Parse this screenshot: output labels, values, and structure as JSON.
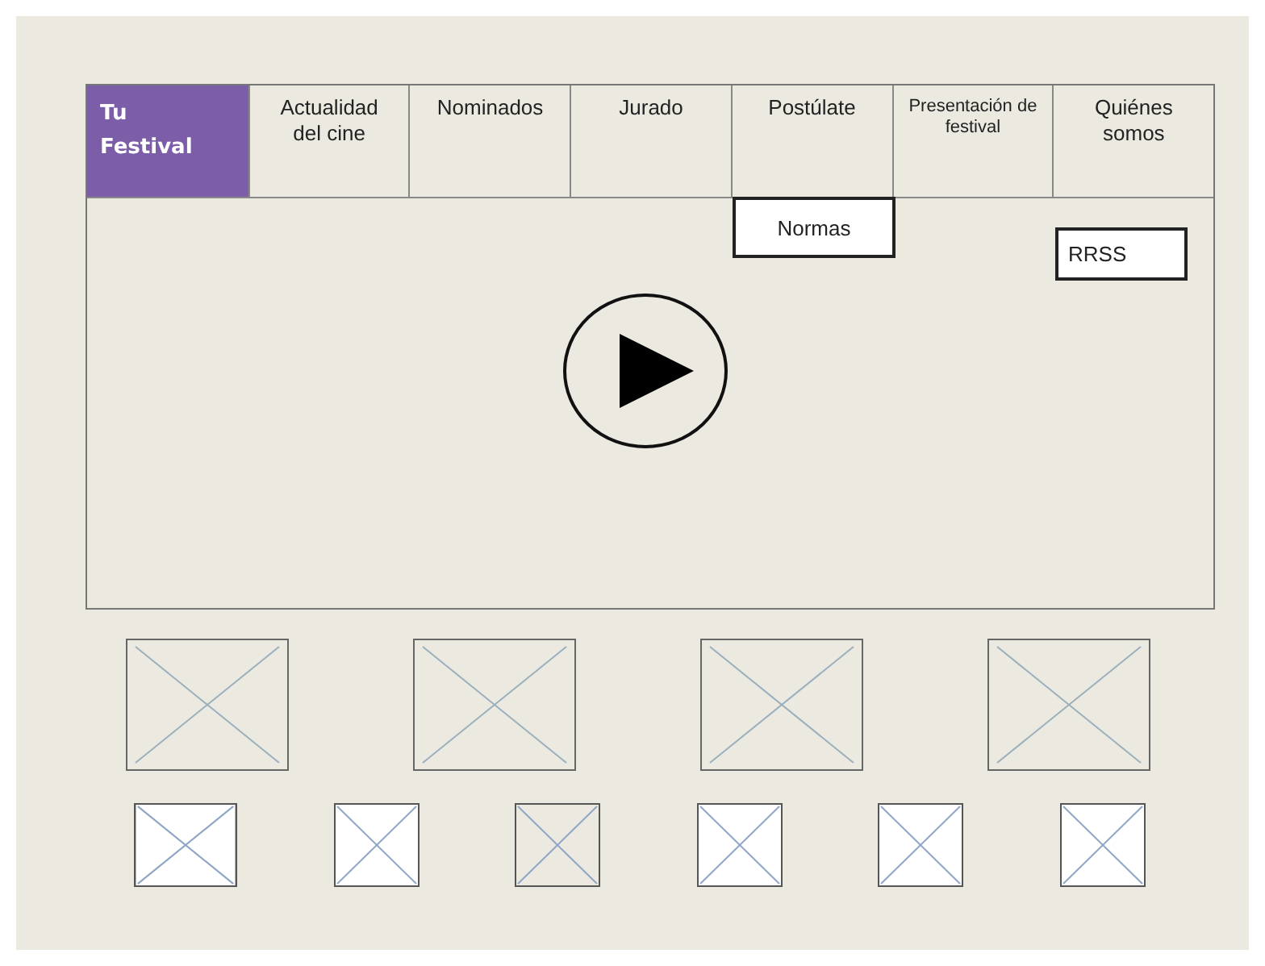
{
  "nav": {
    "tabs": [
      {
        "label": "Tu Festival",
        "selected": true
      },
      {
        "label": "Actualidad del cine",
        "selected": false
      },
      {
        "label": "Nominados",
        "selected": false
      },
      {
        "label": "Jurado",
        "selected": false
      },
      {
        "label": "Postúlate",
        "selected": false
      },
      {
        "label": "Presentación de festival",
        "selected": false
      },
      {
        "label": "Quiénes somos",
        "selected": false
      }
    ]
  },
  "submenu": {
    "items": [
      "Normas"
    ]
  },
  "social_button": "RRSS"
}
